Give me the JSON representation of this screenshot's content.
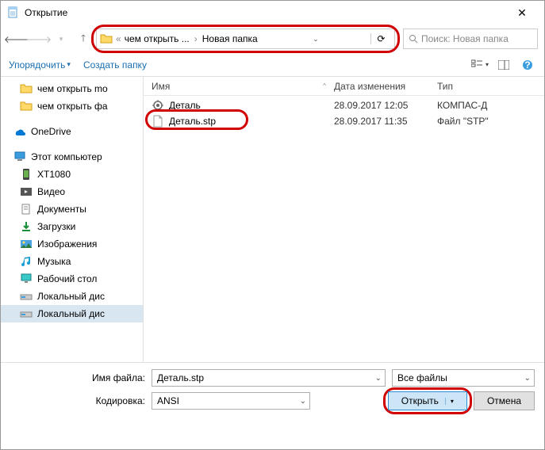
{
  "window": {
    "title": "Открытие"
  },
  "nav": {
    "path_segments": [
      "чем открыть ...",
      "Новая папка"
    ],
    "search_placeholder": "Поиск: Новая папка"
  },
  "toolbar": {
    "organize": "Упорядочить",
    "new_folder": "Создать папку"
  },
  "sidebar": {
    "items": [
      {
        "label": "чем открыть mo",
        "icon": "folder"
      },
      {
        "label": "чем открыть фа",
        "icon": "folder"
      },
      {
        "label": "OneDrive",
        "icon": "onedrive",
        "top": true
      },
      {
        "label": "Этот компьютер",
        "icon": "computer",
        "top": true
      },
      {
        "label": "XT1080",
        "icon": "device"
      },
      {
        "label": "Видео",
        "icon": "video"
      },
      {
        "label": "Документы",
        "icon": "documents"
      },
      {
        "label": "Загрузки",
        "icon": "downloads"
      },
      {
        "label": "Изображения",
        "icon": "pictures"
      },
      {
        "label": "Музыка",
        "icon": "music"
      },
      {
        "label": "Рабочий стол",
        "icon": "desktop"
      },
      {
        "label": "Локальный дис",
        "icon": "disk"
      },
      {
        "label": "Локальный дис",
        "icon": "disk",
        "selected": true
      }
    ]
  },
  "columns": {
    "name": "Имя",
    "date": "Дата изменения",
    "type": "Тип"
  },
  "files": [
    {
      "name": "Деталь",
      "date": "28.09.2017 12:05",
      "type": "КОМПАС-Д",
      "icon": "part"
    },
    {
      "name": "Деталь.stp",
      "date": "28.09.2017 11:35",
      "type": "Файл \"STP\"",
      "icon": "generic"
    }
  ],
  "footer": {
    "filename_label": "Имя файла:",
    "filename_value": "Деталь.stp",
    "filter_value": "Все файлы",
    "encoding_label": "Кодировка:",
    "encoding_value": "ANSI",
    "open": "Открыть",
    "cancel": "Отмена"
  }
}
